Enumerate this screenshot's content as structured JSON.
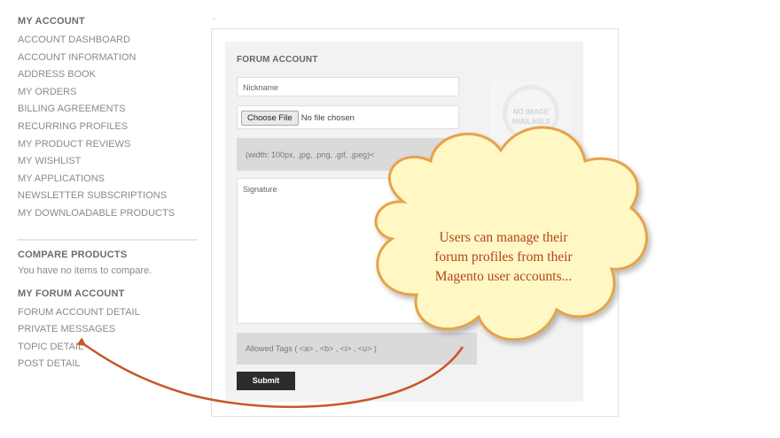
{
  "sidebar": {
    "account_heading": "MY ACCOUNT",
    "account_links": [
      "ACCOUNT DASHBOARD",
      "ACCOUNT INFORMATION",
      "ADDRESS BOOK",
      "MY ORDERS",
      "BILLING AGREEMENTS",
      "RECURRING PROFILES",
      "MY PRODUCT REVIEWS",
      "MY WISHLIST",
      "MY APPLICATIONS",
      "NEWSLETTER SUBSCRIPTIONS",
      "MY DOWNLOADABLE PRODUCTS"
    ],
    "compare_heading": "COMPARE PRODUCTS",
    "compare_text": "You have no items to compare.",
    "forum_heading": "MY FORUM ACCOUNT",
    "forum_links": [
      "FORUM ACCOUNT DETAIL",
      "PRIVATE MESSAGES",
      "TOPIC DETAIL",
      "POST DETAIL"
    ]
  },
  "form": {
    "dot": ".",
    "title": "FORUM ACCOUNT",
    "nickname_placeholder": "Nickname",
    "file_button": "Choose File",
    "file_status": "No file chosen",
    "avatar_hint": "(width: 100px, .jpg, .png, .gif, .jpeg)<",
    "signature_placeholder": "Signature",
    "allowed_tags": "Allowed Tags ( <a> , <b> , <i> , <u> )",
    "no_image_line1": "NO IMAGE",
    "no_image_line2": "AVAILABLE",
    "submit_label": "Submit"
  },
  "callout": {
    "line1": "Users can manage their",
    "line2": "forum profiles from their",
    "line3": "Magento user accounts..."
  },
  "colors": {
    "callout_fill": "#fff7c4",
    "callout_border": "#e6a24a",
    "arrow": "#c8562a"
  }
}
